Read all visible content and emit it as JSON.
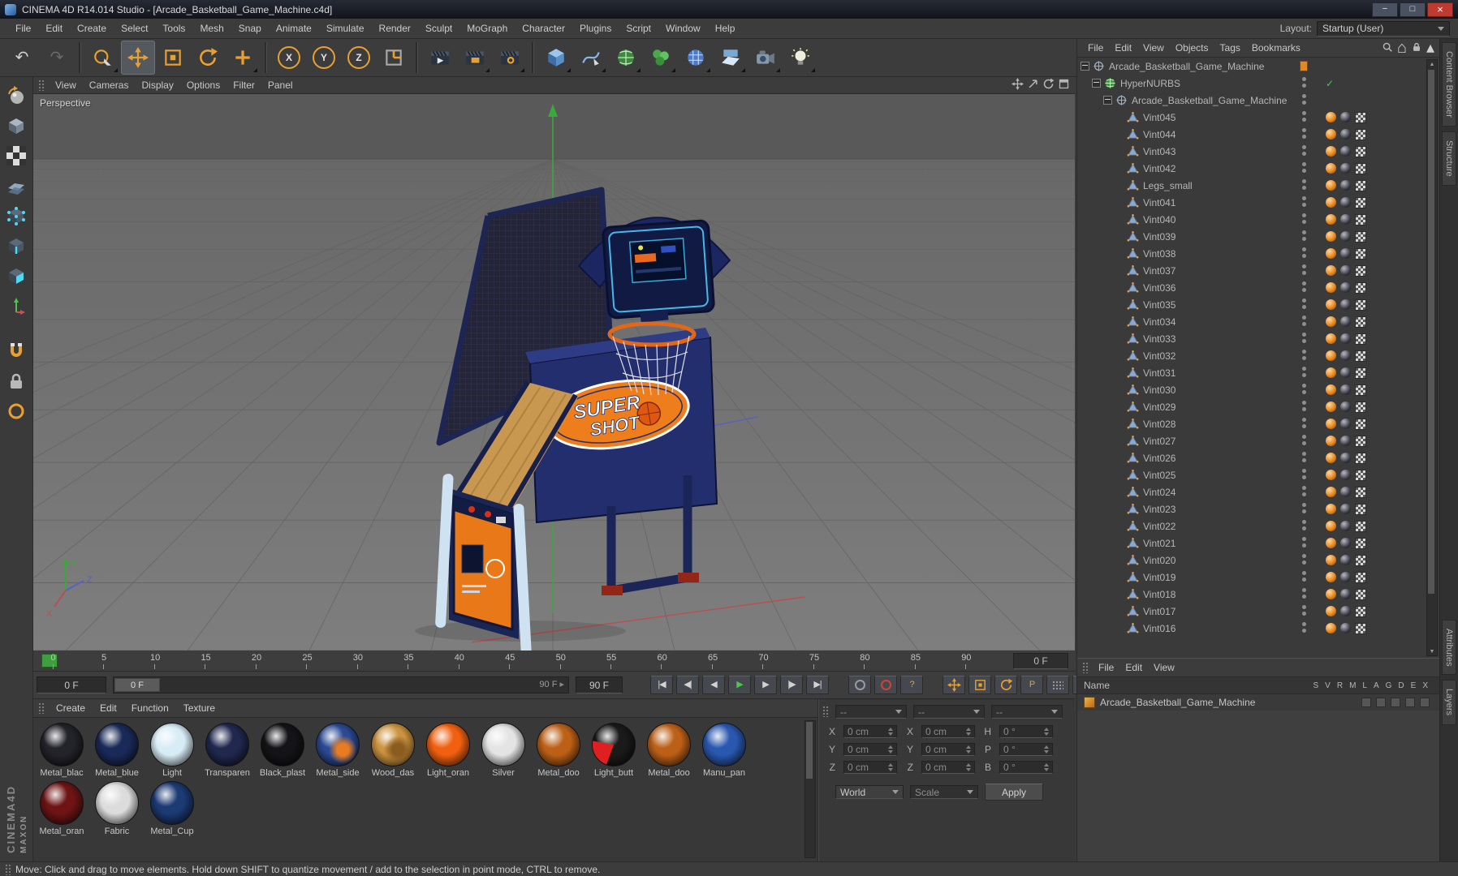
{
  "window": {
    "title": "CINEMA 4D R14.014 Studio - [Arcade_Basketball_Game_Machine.c4d]"
  },
  "menu_bar": {
    "items": [
      "File",
      "Edit",
      "Create",
      "Select",
      "Tools",
      "Mesh",
      "Snap",
      "Animate",
      "Simulate",
      "Render",
      "Sculpt",
      "MoGraph",
      "Character",
      "Plugins",
      "Script",
      "Window",
      "Help"
    ],
    "layout_label": "Layout:",
    "layout_value": "Startup (User)"
  },
  "toolbar": {
    "buttons": [
      {
        "name": "undo-button",
        "icon": "undo-icon"
      },
      {
        "name": "redo-button",
        "icon": "redo-icon"
      },
      {
        "sep": true
      },
      {
        "name": "live-selection-button",
        "icon": "live-selection-icon",
        "popup": true
      },
      {
        "name": "move-button",
        "icon": "move-icon",
        "active": true
      },
      {
        "name": "scale-button",
        "icon": "scale-icon"
      },
      {
        "name": "rotate-button",
        "icon": "rotate-icon"
      },
      {
        "name": "last-tool-button",
        "icon": "plus-icon",
        "popup": true
      },
      {
        "sep": true
      },
      {
        "name": "lock-x-button",
        "icon": "axis-letter-icon",
        "label": "X"
      },
      {
        "name": "lock-y-button",
        "icon": "axis-letter-icon",
        "label": "Y"
      },
      {
        "name": "lock-z-button",
        "icon": "axis-letter-icon",
        "label": "Z"
      },
      {
        "name": "coordinate-system-button",
        "icon": "coord-system-icon"
      },
      {
        "sep": true
      },
      {
        "name": "render-view-button",
        "icon": "render-view-icon"
      },
      {
        "name": "render-picture-viewer-button",
        "icon": "render-pv-icon",
        "popup": true
      },
      {
        "name": "render-settings-button",
        "icon": "render-settings-icon",
        "popup": true
      },
      {
        "sep": true
      },
      {
        "name": "add-primitive-button",
        "icon": "cube-icon",
        "popup": true
      },
      {
        "name": "add-spline-button",
        "icon": "spline-pen-icon",
        "popup": true
      },
      {
        "name": "add-hypernurbs-button",
        "icon": "hypernurbs-icon",
        "popup": true
      },
      {
        "name": "add-mograph-button",
        "icon": "mograph-icon",
        "popup": true
      },
      {
        "name": "add-deformer-button",
        "icon": "deformer-icon",
        "popup": true
      },
      {
        "name": "add-environment-button",
        "icon": "floor-icon",
        "popup": true
      },
      {
        "name": "add-camera-button",
        "icon": "camera-icon",
        "popup": true
      },
      {
        "name": "add-light-button",
        "icon": "light-icon",
        "popup": true
      }
    ]
  },
  "left_toolbar": {
    "buttons": [
      {
        "name": "make-editable-button",
        "icon": "make-editable-icon"
      },
      {
        "name": "model-mode-button",
        "icon": "model-mode-icon"
      },
      {
        "name": "texture-mode-button",
        "icon": "texture-mode-icon"
      },
      {
        "name": "workplane-mode-button",
        "icon": "workplane-icon"
      },
      {
        "name": "points-mode-button",
        "icon": "points-mode-icon"
      },
      {
        "name": "edges-mode-button",
        "icon": "edges-mode-icon"
      },
      {
        "name": "polygons-mode-button",
        "icon": "polygons-mode-icon"
      },
      {
        "name": "axis-mode-button",
        "icon": "axis-mode-icon"
      },
      {
        "gap": true
      },
      {
        "name": "snap-settings-button",
        "icon": "magnet-icon"
      },
      {
        "name": "workplane-lock-button",
        "icon": "lock-icon"
      },
      {
        "name": "quantize-button",
        "icon": "ring-icon"
      }
    ]
  },
  "viewport": {
    "menu": [
      "View",
      "Cameras",
      "Display",
      "Options",
      "Filter",
      "Panel"
    ],
    "nav_icons": [
      "pan-view-icon",
      "zoom-view-icon",
      "rotate-view-icon",
      "maximize-view-icon"
    ],
    "label": "Perspective",
    "logo_line1": "SUPER",
    "logo_line2": "SHOT",
    "axis_gizmo": {
      "x": "X",
      "y": "Y",
      "z": "Z"
    }
  },
  "timeline": {
    "ticks": [
      0,
      5,
      10,
      15,
      20,
      25,
      30,
      35,
      40,
      45,
      50,
      55,
      60,
      65,
      70,
      75,
      80,
      85,
      90
    ],
    "end_field": "0 F"
  },
  "playbar": {
    "start_value": "0 F",
    "slider_left": "0 F",
    "slider_right": "90 F",
    "end_value": "90 F",
    "transport": [
      {
        "name": "goto-start-button",
        "icon": "goto-start-icon"
      },
      {
        "name": "goto-previous-key-button",
        "icon": "prev-key-icon"
      },
      {
        "name": "previous-frame-button",
        "icon": "prev-frame-icon"
      },
      {
        "name": "play-button",
        "icon": "play-icon"
      },
      {
        "name": "next-frame-button",
        "icon": "next-frame-icon"
      },
      {
        "name": "goto-next-key-button",
        "icon": "next-key-icon"
      },
      {
        "name": "goto-end-button",
        "icon": "goto-end-icon"
      },
      {
        "spacer": true
      },
      {
        "name": "record-keyframe-button",
        "icon": "record-icon"
      },
      {
        "name": "autokeying-button",
        "icon": "autokey-icon"
      },
      {
        "name": "help-button",
        "icon": "help-icon"
      },
      {
        "spacer": true
      },
      {
        "name": "quick-move-button",
        "icon": "move-icon"
      },
      {
        "name": "quick-scale-button",
        "icon": "scale-icon"
      },
      {
        "name": "quick-rotate-button",
        "icon": "rotate-icon"
      },
      {
        "name": "parent-mode-button",
        "icon": "p-icon"
      },
      {
        "name": "icon-palette-button",
        "icon": "grid-icon"
      },
      {
        "name": "picture-viewer-button",
        "icon": "picture-icon"
      }
    ]
  },
  "materials": {
    "menu": [
      "Create",
      "Edit",
      "Function",
      "Texture"
    ],
    "items": [
      {
        "name": "Metal_blac",
        "color": "#23232a"
      },
      {
        "name": "Metal_blue",
        "color": "#1a2a58"
      },
      {
        "name": "Light",
        "color": "#d8ecf6"
      },
      {
        "name": "Transparen",
        "color": "#20284e"
      },
      {
        "name": "Black_plast",
        "color": "#141418"
      },
      {
        "name": "Metal_side",
        "color": "#2a4a94",
        "accent": "#e87c20"
      },
      {
        "name": "Wood_das",
        "color": "#cc9440",
        "accent": "#8a5c20"
      },
      {
        "name": "Light_oran",
        "color": "#f06010"
      },
      {
        "name": "Silver",
        "color": "#e4e4e4"
      },
      {
        "name": "Metal_doo",
        "color": "#bc6018"
      },
      {
        "name": "Light_butt",
        "color": "#1a1a1a",
        "wedge": "#e02020"
      },
      {
        "name": "Metal_doo",
        "color": "#bc6018"
      },
      {
        "name": "Manu_pan",
        "color": "#2a58b0"
      },
      {
        "name": "Metal_oran",
        "color": "#6e1414"
      },
      {
        "name": "Fabric",
        "color": "#dcdcdc"
      },
      {
        "name": "Metal_Cup",
        "color": "#1c3a74"
      }
    ]
  },
  "coordinates": {
    "headers": [
      "--",
      "--",
      "--"
    ],
    "grid": [
      {
        "c1_label": "X",
        "c1": "0 cm",
        "c2_label": "X",
        "c2": "0 cm",
        "c3_label": "H",
        "c3": "0 °"
      },
      {
        "c1_label": "Y",
        "c1": "0 cm",
        "c2_label": "Y",
        "c2": "0 cm",
        "c3_label": "P",
        "c3": "0 °"
      },
      {
        "c1_label": "Z",
        "c1": "0 cm",
        "c2_label": "Z",
        "c2": "0 cm",
        "c3_label": "B",
        "c3": "0 °"
      }
    ],
    "world_value": "World",
    "scale_value": "Scale",
    "apply_label": "Apply"
  },
  "object_manager": {
    "menu": [
      "File",
      "Edit",
      "View",
      "Objects",
      "Tags",
      "Bookmarks"
    ],
    "right_icons": [
      "search-icon",
      "home-icon",
      "padlock-icon",
      "collapse-icon"
    ],
    "tree": {
      "root": "Arcade_Basketball_Game_Machine",
      "generator": "HyperNURBS",
      "group": "Arcade_Basketball_Game_Machine",
      "children": [
        "Vint045",
        "Vint044",
        "Vint043",
        "Vint042",
        "Legs_small",
        "Vint041",
        "Vint040",
        "Vint039",
        "Vint038",
        "Vint037",
        "Vint036",
        "Vint035",
        "Vint034",
        "Vint033",
        "Vint032",
        "Vint031",
        "Vint030",
        "Vint029",
        "Vint028",
        "Vint027",
        "Vint026",
        "Vint025",
        "Vint024",
        "Vint023",
        "Vint022",
        "Vint021",
        "Vint020",
        "Vint019",
        "Vint018",
        "Vint017",
        "Vint016"
      ]
    }
  },
  "layer_panel": {
    "menu": [
      "File",
      "Edit",
      "View"
    ],
    "name_header": "Name",
    "columns": [
      "S",
      "V",
      "R",
      "M",
      "L",
      "A",
      "G",
      "D",
      "E",
      "X"
    ],
    "rows": [
      {
        "label": "Arcade_Basketball_Game_Machine"
      }
    ]
  },
  "side_strip": {
    "tabs_top": [
      "Content Browser",
      "Structure"
    ],
    "tabs_bottom": [
      "Attributes",
      "Layers"
    ]
  },
  "branding": {
    "line1": "MAXON",
    "line2": "CINEMA4D"
  },
  "status_bar": {
    "text": "Move: Click and drag to move elements. Hold down SHIFT to quantize movement / add to the selection in point mode, CTRL to remove."
  }
}
